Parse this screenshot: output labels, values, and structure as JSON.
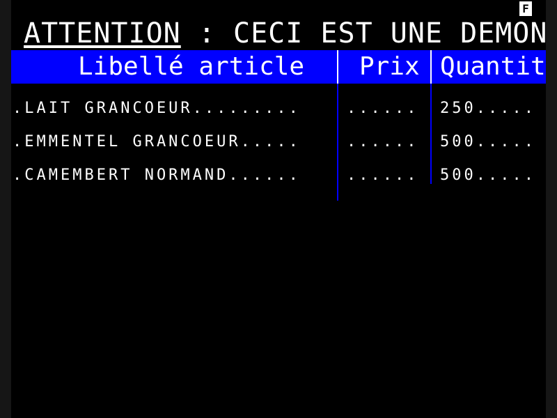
{
  "status": {
    "indicator": "F"
  },
  "banner": {
    "word1": "ATTENTION",
    "rest": " : CECI EST UNE DEMONTRATION"
  },
  "table": {
    "headers": {
      "label": "Libellé article",
      "price": "Prix",
      "quantity": "Quantité"
    },
    "rows": [
      {
        "label": ".LAIT GRANCOEUR.........",
        "price": "......",
        "quantity": "250....."
      },
      {
        "label": ".EMMENTEL GRANCOEUR.....",
        "price": "......",
        "quantity": "500....."
      },
      {
        "label": ".CAMEMBERT NORMAND......",
        "price": "......",
        "quantity": "500....."
      }
    ]
  },
  "colors": {
    "header_bg": "#0000ff",
    "background": "#000000",
    "text": "#ffffff"
  }
}
